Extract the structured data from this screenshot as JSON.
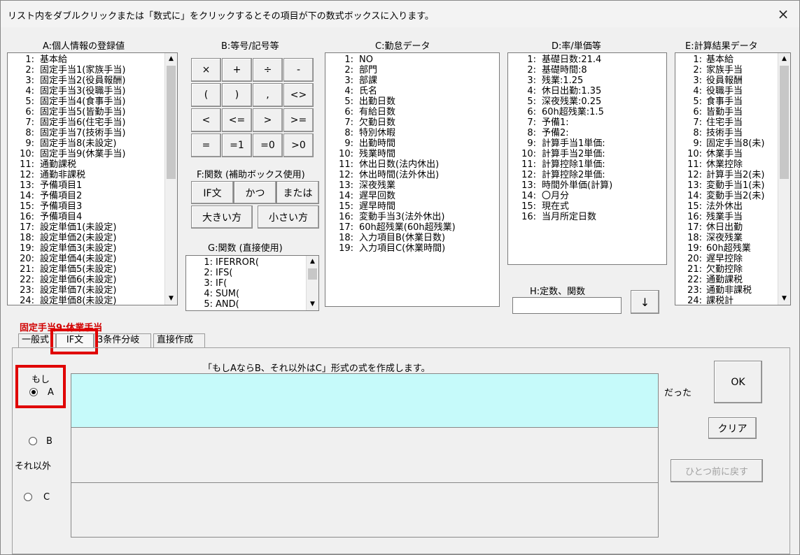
{
  "window": {
    "title": "リスト内をダブルクリックまたは「数式に」をクリックするとその項目が下の数式ボックスに入ります。",
    "close_icon": "×"
  },
  "list_a": {
    "label": "A:個人情報の登録値",
    "items": [
      {
        "n": "1:",
        "t": "基本給"
      },
      {
        "n": "2:",
        "t": "固定手当1(家族手当)"
      },
      {
        "n": "3:",
        "t": "固定手当2(役員報酬)"
      },
      {
        "n": "4:",
        "t": "固定手当3(役職手当)"
      },
      {
        "n": "5:",
        "t": "固定手当4(食事手当)"
      },
      {
        "n": "6:",
        "t": "固定手当5(皆勤手当)"
      },
      {
        "n": "7:",
        "t": "固定手当6(住宅手当)"
      },
      {
        "n": "8:",
        "t": "固定手当7(技術手当)"
      },
      {
        "n": "9:",
        "t": "固定手当8(未設定)"
      },
      {
        "n": "10:",
        "t": "固定手当9(休業手当)"
      },
      {
        "n": "11:",
        "t": "通勤課税"
      },
      {
        "n": "12:",
        "t": "通勤非課税"
      },
      {
        "n": "13:",
        "t": "予備項目1"
      },
      {
        "n": "14:",
        "t": "予備項目2"
      },
      {
        "n": "15:",
        "t": "予備項目3"
      },
      {
        "n": "16:",
        "t": "予備項目4"
      },
      {
        "n": "17:",
        "t": "設定単価1(未設定)"
      },
      {
        "n": "18:",
        "t": "設定単価2(未設定)"
      },
      {
        "n": "19:",
        "t": "設定単価3(未設定)"
      },
      {
        "n": "20:",
        "t": "設定単価4(未設定)"
      },
      {
        "n": "21:",
        "t": "設定単価5(未設定)"
      },
      {
        "n": "22:",
        "t": "設定単価6(未設定)"
      },
      {
        "n": "23:",
        "t": "設定単価7(未設定)"
      },
      {
        "n": "24:",
        "t": "設定単価8(未設定)"
      }
    ]
  },
  "symbols": {
    "label": "B:等号/記号等",
    "rows": [
      [
        "×",
        "+",
        "÷",
        "-"
      ],
      [
        "(",
        ")",
        ",",
        "<>"
      ],
      [
        "<",
        "<=",
        ">",
        ">="
      ],
      [
        "=",
        "=1",
        "=0",
        ">0"
      ]
    ]
  },
  "functions_f": {
    "label": "F:関数 (補助ボックス使用)",
    "row1": [
      "IF文",
      "かつ",
      "または"
    ],
    "row2": [
      "大きい方",
      "小さい方"
    ]
  },
  "functions_g": {
    "label": "G:関数 (直接使用)",
    "items": [
      {
        "n": "1:",
        "t": "IFERROR("
      },
      {
        "n": "2:",
        "t": "IFS("
      },
      {
        "n": "3:",
        "t": "IF("
      },
      {
        "n": "4:",
        "t": "SUM("
      },
      {
        "n": "5:",
        "t": "AND("
      }
    ]
  },
  "list_c": {
    "label": "C:勤怠データ",
    "items": [
      {
        "n": "1:",
        "t": "NO"
      },
      {
        "n": "2:",
        "t": "部門"
      },
      {
        "n": "3:",
        "t": "部課"
      },
      {
        "n": "4:",
        "t": "氏名"
      },
      {
        "n": "5:",
        "t": "出勤日数"
      },
      {
        "n": "6:",
        "t": "有給日数"
      },
      {
        "n": "7:",
        "t": "欠勤日数"
      },
      {
        "n": "8:",
        "t": "特別休暇"
      },
      {
        "n": "9:",
        "t": "出勤時間"
      },
      {
        "n": "10:",
        "t": "残業時間"
      },
      {
        "n": "11:",
        "t": "休出日数(法内休出)"
      },
      {
        "n": "12:",
        "t": "休出時間(法外休出)"
      },
      {
        "n": "13:",
        "t": "深夜残業"
      },
      {
        "n": "14:",
        "t": "遅早回数"
      },
      {
        "n": "15:",
        "t": "遅早時間"
      },
      {
        "n": "16:",
        "t": "変動手当3(法外休出)"
      },
      {
        "n": "17:",
        "t": "60h超残業(60h超残業)"
      },
      {
        "n": "18:",
        "t": "入力項目B(休業日数)"
      },
      {
        "n": "19:",
        "t": "入力項目C(休業時間)"
      }
    ]
  },
  "list_d": {
    "label": "D:率/単価等",
    "items": [
      {
        "n": "1:",
        "t": "基礎日数:21.4"
      },
      {
        "n": "2:",
        "t": "基礎時間:8"
      },
      {
        "n": "3:",
        "t": "残業:1.25"
      },
      {
        "n": "4:",
        "t": "休日出勤:1.35"
      },
      {
        "n": "5:",
        "t": "深夜残業:0.25"
      },
      {
        "n": "6:",
        "t": "60h超残業:1.5"
      },
      {
        "n": "7:",
        "t": "予備1:"
      },
      {
        "n": "8:",
        "t": "予備2:"
      },
      {
        "n": "9:",
        "t": "計算手当1単価:"
      },
      {
        "n": "10:",
        "t": "計算手当2単価:"
      },
      {
        "n": "11:",
        "t": "計算控除1単価:"
      },
      {
        "n": "12:",
        "t": "計算控除2単価:"
      },
      {
        "n": "13:",
        "t": "時間外単価(計算)"
      },
      {
        "n": "14:",
        "t": "〇月分"
      },
      {
        "n": "15:",
        "t": "現在式"
      },
      {
        "n": "16:",
        "t": "当月所定日数"
      }
    ]
  },
  "constants_h": {
    "label": "H:定数、関数",
    "value": "",
    "insert_icon": "↓"
  },
  "list_e": {
    "label": "E:計算結果データ",
    "items": [
      {
        "n": "1:",
        "t": "基本給"
      },
      {
        "n": "2:",
        "t": "家族手当"
      },
      {
        "n": "3:",
        "t": "役員報酬"
      },
      {
        "n": "4:",
        "t": "役職手当"
      },
      {
        "n": "5:",
        "t": "食事手当"
      },
      {
        "n": "6:",
        "t": "皆勤手当"
      },
      {
        "n": "7:",
        "t": "住宅手当"
      },
      {
        "n": "8:",
        "t": "技術手当"
      },
      {
        "n": "9:",
        "t": "固定手当8(未)"
      },
      {
        "n": "10:",
        "t": "休業手当"
      },
      {
        "n": "11:",
        "t": "休業控除"
      },
      {
        "n": "12:",
        "t": "計算手当2(未)"
      },
      {
        "n": "13:",
        "t": "変動手当1(未)"
      },
      {
        "n": "14:",
        "t": "変動手当2(未)"
      },
      {
        "n": "15:",
        "t": "法外休出"
      },
      {
        "n": "16:",
        "t": "残業手当"
      },
      {
        "n": "17:",
        "t": "休日出勤"
      },
      {
        "n": "18:",
        "t": "深夜残業"
      },
      {
        "n": "19:",
        "t": "60h超残業"
      },
      {
        "n": "20:",
        "t": "遅早控除"
      },
      {
        "n": "21:",
        "t": "欠勤控除"
      },
      {
        "n": "22:",
        "t": "通勤課税"
      },
      {
        "n": "23:",
        "t": "通勤非課税"
      },
      {
        "n": "24:",
        "t": "課税計"
      }
    ]
  },
  "current_item": "固定手当9:休業手当",
  "tabs": [
    "一般式",
    "IF文",
    "3条件分岐",
    "直接作成"
  ],
  "if_panel": {
    "description": "「もしAならB、それ以外はC」形式の式を作成します。",
    "moshi": "もし",
    "radio_a": "A",
    "radio_b": "B",
    "radio_c": "C",
    "sore_igai": "それ以外",
    "datta": "だった",
    "field_a": "",
    "field_b": "",
    "field_c": ""
  },
  "buttons": {
    "ok": "OK",
    "clear": "クリア",
    "undo": "ひとつ前に戻す"
  },
  "colors": {
    "active_field": "#c6fafa",
    "highlight": "#e00000"
  }
}
